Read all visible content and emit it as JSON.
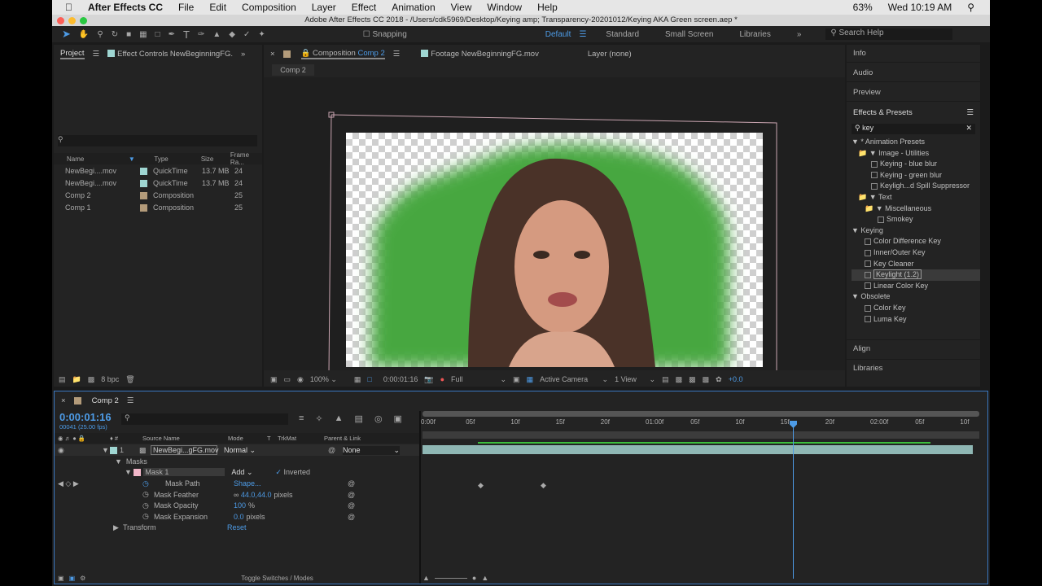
{
  "menubar": {
    "app": "After Effects CC",
    "items": [
      "File",
      "Edit",
      "Composition",
      "Layer",
      "Effect",
      "Animation",
      "View",
      "Window",
      "Help"
    ],
    "battery": "63%",
    "clock": "Wed 10:19 AM"
  },
  "window_title": "Adobe After Effects CC 2018 - /Users/cdk5969/Desktop/Keying amp; Transparency-20201012/Keying AKA Green screen.aep *",
  "toolbar": {
    "snapping": "Snapping",
    "workspaces": [
      "Default",
      "Standard",
      "Small Screen",
      "Libraries"
    ],
    "search": "Search Help"
  },
  "project": {
    "tab": "Project",
    "effect_controls": "Effect Controls NewBeginningFG.",
    "columns": [
      "Name",
      "Type",
      "Size",
      "Frame Ra..."
    ],
    "items": [
      {
        "name": "NewBegi....mov",
        "type": "QuickTime",
        "size": "13.7 MB",
        "fps": "24"
      },
      {
        "name": "NewBegi....mov",
        "type": "QuickTime",
        "size": "13.7 MB",
        "fps": "24"
      },
      {
        "name": "Comp 2",
        "type": "Composition",
        "size": "",
        "fps": "25"
      },
      {
        "name": "Comp 1",
        "type": "Composition",
        "size": "",
        "fps": "25"
      }
    ],
    "bpc": "8 bpc"
  },
  "composition": {
    "tab_prefix": "Composition",
    "tab_name": "Comp 2",
    "footage_tab": "Footage NewBeginningFG.mov",
    "layer_tab": "Layer (none)",
    "subtab": "Comp 2",
    "zoom": "100%",
    "time": "0:00:01:16",
    "resolution": "Full",
    "camera": "Active Camera",
    "views": "1 View",
    "exposure": "+0.0"
  },
  "right_panels": {
    "info": "Info",
    "audio": "Audio",
    "preview": "Preview",
    "effects": "Effects & Presets",
    "search": "key",
    "align": "Align",
    "libraries": "Libraries",
    "tree": [
      {
        "t": "▼ * Animation Presets",
        "l": 0
      },
      {
        "t": "▼ Image - Utilities",
        "l": 1,
        "f": 1
      },
      {
        "t": "Keying - blue blur",
        "l": 3,
        "p": 1
      },
      {
        "t": "Keying - green blur",
        "l": 3,
        "p": 1
      },
      {
        "t": "Keyligh...d Spill Suppressor",
        "l": 3,
        "p": 1
      },
      {
        "t": "▼ Text",
        "l": 1,
        "f": 1
      },
      {
        "t": "▼ Miscellaneous",
        "l": 2,
        "f": 1
      },
      {
        "t": "Smokey",
        "l": 4,
        "p": 1
      },
      {
        "t": "▼ Keying",
        "l": 0
      },
      {
        "t": "Color Difference Key",
        "l": 2,
        "p": 1
      },
      {
        "t": "Inner/Outer Key",
        "l": 2,
        "p": 1
      },
      {
        "t": "Key Cleaner",
        "l": 2,
        "p": 1
      },
      {
        "t": "Keylight (1.2)",
        "l": 2,
        "p": 1,
        "sel": 1
      },
      {
        "t": "Linear Color Key",
        "l": 2,
        "p": 1
      },
      {
        "t": "▼ Obsolete",
        "l": 0
      },
      {
        "t": "Color Key",
        "l": 2,
        "p": 1
      },
      {
        "t": "Luma Key",
        "l": 2,
        "p": 1
      }
    ]
  },
  "timeline": {
    "tab": "Comp 2",
    "time": "0:00:01:16",
    "frames": "00041 (25.00 fps)",
    "columns": {
      "source": "Source Name",
      "mode": "Mode",
      "t": "T",
      "trkmat": "TrkMat",
      "parent": "Parent & Link"
    },
    "layer": {
      "num": "1",
      "name": "NewBegi...gFG.mov",
      "mode": "Normal",
      "parent": "None"
    },
    "masks": "Masks",
    "mask1": "Mask 1",
    "mask_mode": "Add",
    "inverted": "Inverted",
    "props": [
      {
        "name": "Mask Path",
        "value": "Shape..."
      },
      {
        "name": "Mask Feather",
        "value": "44.0,44.0",
        "unit": "pixels"
      },
      {
        "name": "Mask Opacity",
        "value": "100",
        "unit": "%"
      },
      {
        "name": "Mask Expansion",
        "value": "0.0",
        "unit": "pixels"
      }
    ],
    "transform": "Transform",
    "reset": "Reset",
    "ruler": [
      "0:00f",
      "05f",
      "10f",
      "15f",
      "20f",
      "01:00f",
      "05f",
      "10f",
      "15f",
      "20f",
      "02:00f",
      "05f",
      "10f"
    ],
    "toggle": "Toggle Switches / Modes"
  }
}
